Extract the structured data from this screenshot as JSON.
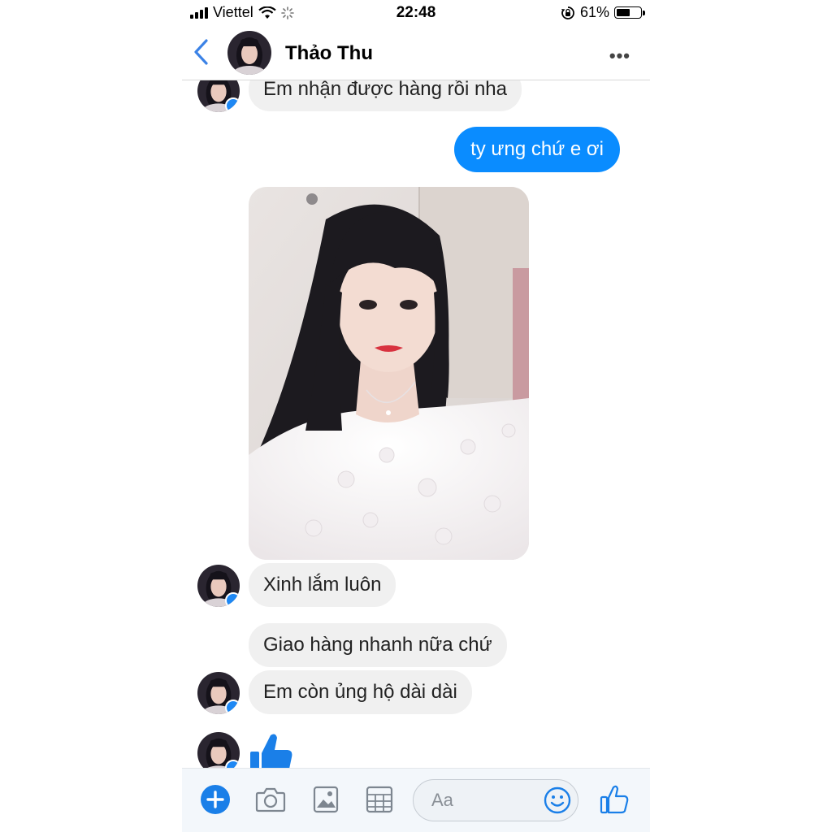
{
  "status_bar": {
    "carrier": "Viettel",
    "time": "22:48",
    "battery_text": "61%",
    "battery_level": 0.61
  },
  "header": {
    "contact_name": "Thảo Thu",
    "more_label": "•••"
  },
  "messages": [
    {
      "id": "m1",
      "from": "contact",
      "type": "text",
      "text": "Em nhận được hàng rồi nha"
    },
    {
      "id": "m2",
      "from": "me",
      "type": "text",
      "text": "ty ưng chứ e ơi"
    },
    {
      "id": "m3",
      "from": "contact",
      "type": "image"
    },
    {
      "id": "m4",
      "from": "contact",
      "type": "text",
      "text": "Xinh lắm luôn"
    },
    {
      "id": "m5",
      "from": "contact",
      "type": "text",
      "text": "Giao hàng nhanh nữa chứ"
    },
    {
      "id": "m6",
      "from": "contact",
      "type": "text",
      "text": "Em còn ủng hộ dài dài"
    },
    {
      "id": "m7",
      "from": "contact",
      "type": "like-sticker"
    }
  ],
  "composer": {
    "placeholder": "Aa",
    "icons": [
      "plus-icon",
      "camera-icon",
      "gallery-icon",
      "grid-icon",
      "emoji-icon",
      "thumbs-up-icon"
    ]
  },
  "colors": {
    "accent": "#0a8cff",
    "incoming_bubble": "#f0f0f0",
    "icon_blue": "#1a7fe8",
    "messenger_badge": "#1e88f4"
  }
}
